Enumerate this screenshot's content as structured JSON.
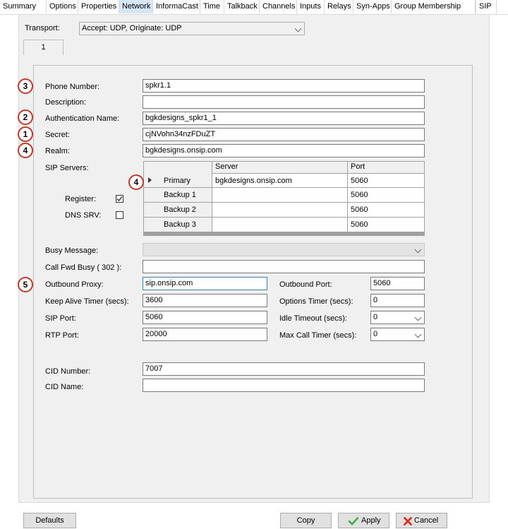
{
  "tabs": [
    "Summary",
    "Options",
    "Properties",
    "Network",
    "InformaCast",
    "Time",
    "Talkback",
    "Channels",
    "Inputs",
    "Relays",
    "Syn-Apps",
    "Group Membership",
    "SIP"
  ],
  "transport": {
    "label": "Transport:",
    "value": "Accept: UDP, Originate: UDP"
  },
  "subtab": "1",
  "badges": {
    "phone": "3",
    "auth": "2",
    "secret": "1",
    "realm": "4",
    "primary": "4",
    "proxy": "5"
  },
  "fields": {
    "phone_number": {
      "label": "Phone Number:",
      "value": "spkr1.1"
    },
    "description": {
      "label": "Description:",
      "value": ""
    },
    "auth_name": {
      "label": "Authentication Name:",
      "value": "bgkdesigns_spkr1_1"
    },
    "secret": {
      "label": "Secret:",
      "value": "cjNVohn34nzFDuZT"
    },
    "realm": {
      "label": "Realm:",
      "value": "bgkdesigns.onsip.com"
    }
  },
  "sip_servers": {
    "label": "SIP Servers:",
    "col_server": "Server",
    "col_port": "Port",
    "rows": [
      {
        "name": "Primary",
        "server": "bgkdesigns.onsip.com",
        "port": "5060"
      },
      {
        "name": "Backup 1",
        "server": "",
        "port": "5060"
      },
      {
        "name": "Backup 2",
        "server": "",
        "port": "5060"
      },
      {
        "name": "Backup 3",
        "server": "",
        "port": "5060"
      }
    ]
  },
  "register": {
    "label": "Register:",
    "checked": true
  },
  "dns_srv": {
    "label": "DNS SRV:",
    "checked": false
  },
  "busy_message": {
    "label": "Busy Message:",
    "value": ""
  },
  "call_fwd_busy": {
    "label": "Call Fwd Busy ( 302 ):",
    "value": ""
  },
  "outbound_proxy": {
    "label": "Outbound Proxy:",
    "value": "sip.onsip.com"
  },
  "outbound_port": {
    "label": "Outbound Port:",
    "value": "5060"
  },
  "keep_alive": {
    "label": "Keep Alive Timer (secs):",
    "value": "3600"
  },
  "options_timer": {
    "label": "Options Timer (secs):",
    "value": "0"
  },
  "sip_port": {
    "label": "SIP Port:",
    "value": "5060"
  },
  "idle_timeout": {
    "label": "Idle Timeout (secs):",
    "value": "0"
  },
  "rtp_port": {
    "label": "RTP Port:",
    "value": "20000"
  },
  "max_call_timer": {
    "label": "Max Call Timer (secs):",
    "value": "0"
  },
  "cid_number": {
    "label": "CID Number:",
    "value": "7007"
  },
  "cid_name": {
    "label": "CID Name:",
    "value": ""
  },
  "buttons": {
    "defaults": "Defaults",
    "copy": "Copy",
    "apply": "Apply",
    "cancel": "Cancel"
  },
  "colors": {
    "badge_ring": "#c0392b",
    "apply_check": "#3cae3c",
    "cancel_x": "#d93025",
    "tab_highlight": "#d7e6f7"
  }
}
